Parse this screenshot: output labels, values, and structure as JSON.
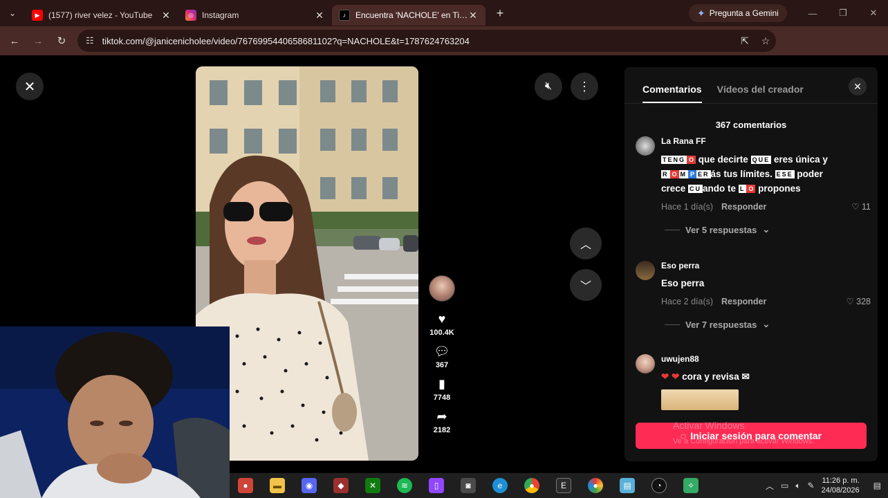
{
  "browser": {
    "tabs": [
      {
        "title": "(1577) river velez - YouTube",
        "favicon": "youtube-icon",
        "color": "#ff0000"
      },
      {
        "title": "Instagram",
        "favicon": "instagram-icon",
        "color": "#d62976"
      },
      {
        "title": "Encuentra 'NACHOLE' en TikTok",
        "favicon": "tiktok-icon",
        "color": "#000000"
      }
    ],
    "gemini_label": "Pregunta a Gemini",
    "url": "tiktok.com/@janicenicholee/video/7676995440658681102?q=NACHOLE&t=1787624763204"
  },
  "video": {
    "likes": "100.4K",
    "comments": "367",
    "saves": "7748",
    "shares": "2182"
  },
  "panel": {
    "tab_comments": "Comentarios",
    "tab_creator_videos": "Vídeos del creador",
    "comment_count": "367 comentarios",
    "comments": [
      {
        "user": "La Rana FF",
        "time": "Hace 1 día(s)",
        "reply": "Responder",
        "likes": "11",
        "more_replies": "Ver 5 respuestas"
      },
      {
        "user": "Eso perra",
        "text": "Eso perra",
        "time": "Hace 2 día(s)",
        "reply": "Responder",
        "likes": "328",
        "more_replies": "Ver 7 respuestas"
      },
      {
        "user": "uwujen88",
        "text": "cora y revisa"
      }
    ],
    "login_button": "Iniciar sesión para comentar",
    "watermark_1": "Activar Windows",
    "watermark_2": "Ve a Configuración para activar Windows."
  },
  "taskbar": {
    "time": "11:26 p. m.",
    "date": "24/08/2026"
  },
  "colors": {
    "accent": "#fe2c55",
    "chrome_tabbar": "#2a1614",
    "chrome_toolbar": "#4a2a26"
  }
}
